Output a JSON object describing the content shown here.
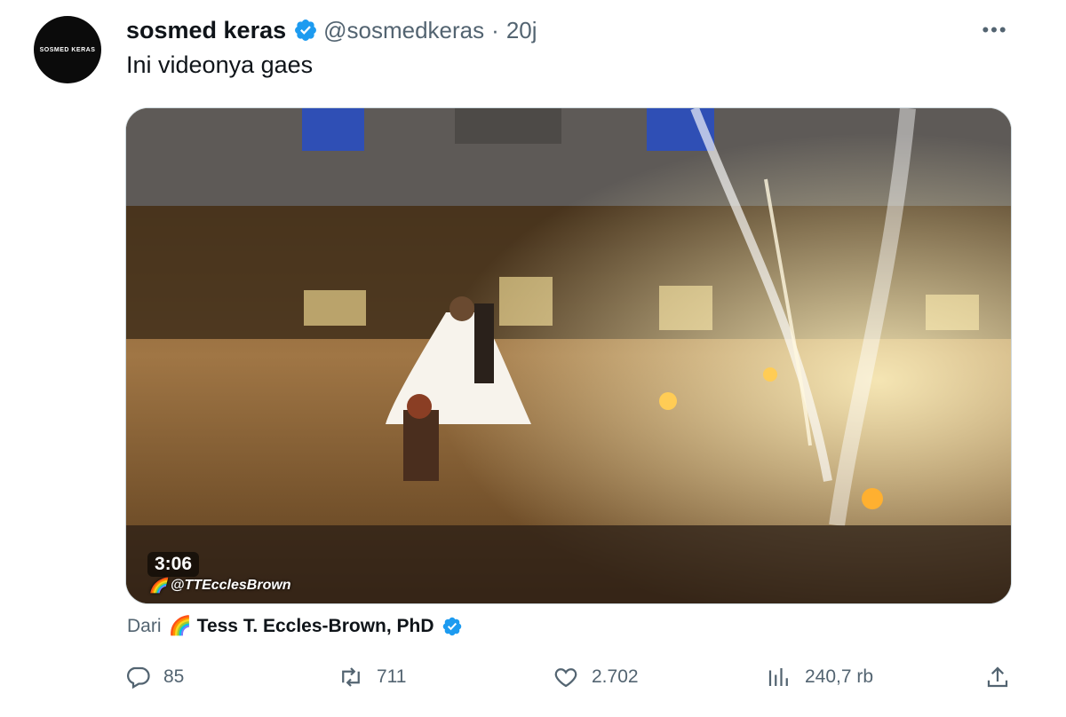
{
  "tweet": {
    "avatar_text": "SOSMED KERAS",
    "name": "sosmed keras",
    "handle": "@sosmedkeras",
    "separator": "·",
    "time": "20j",
    "text": "Ini videonya gaes",
    "more_icon": "more-horizontal-icon",
    "verified_icon": "verified-badge-icon",
    "accent_color": "#1d9bf0"
  },
  "media": {
    "duration": "3:06",
    "watermark_emoji": "🌈",
    "watermark_handle": "@TTEcclesBrown"
  },
  "source": {
    "label": "Dari",
    "emoji": "🌈",
    "name": "Tess T. Eccles-Brown, PhD"
  },
  "actions": {
    "replies": "85",
    "retweets": "711",
    "likes": "2.702",
    "views": "240,7 rb"
  }
}
